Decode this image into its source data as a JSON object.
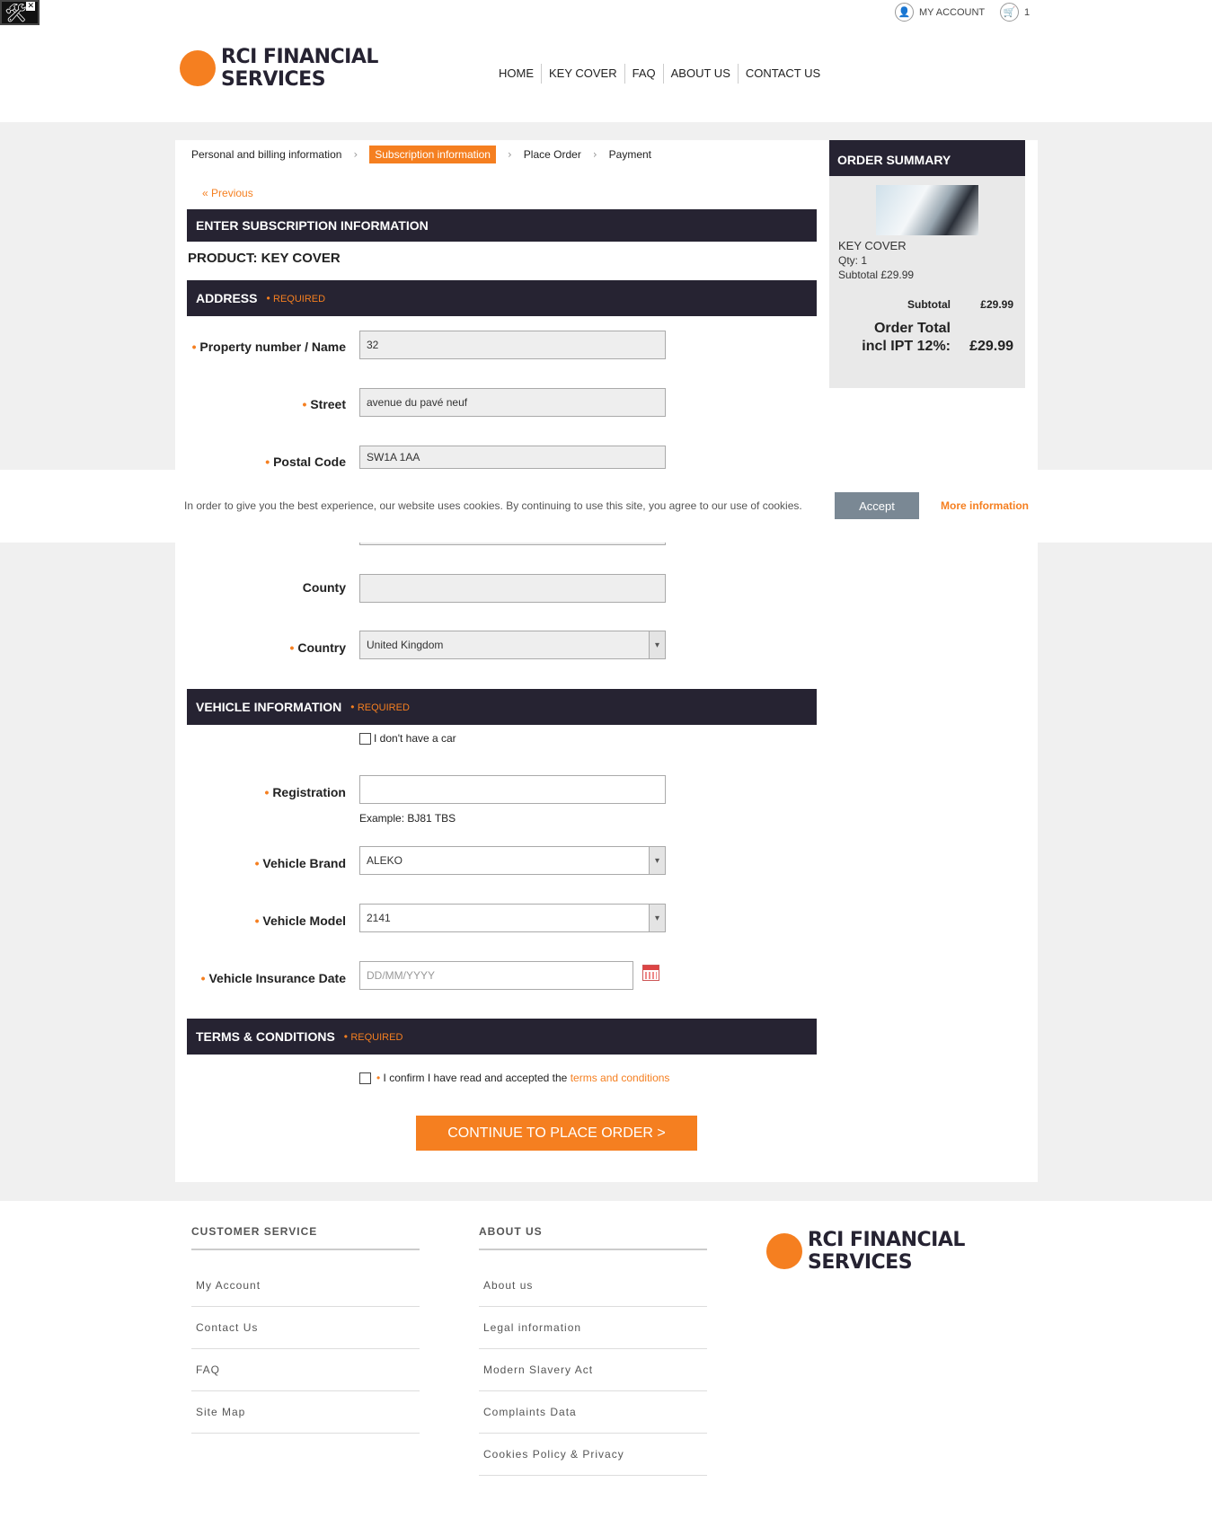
{
  "topbar": {
    "my_account": "MY ACCOUNT",
    "cart_count": "1"
  },
  "brand": {
    "line1": "RCI FINANCIAL",
    "line2": "SERVICES",
    "color": "#f57f20"
  },
  "nav": [
    "HOME",
    "KEY COVER",
    "FAQ",
    "ABOUT US",
    "CONTACT US"
  ],
  "steps": [
    "Personal and billing information",
    "Subscription information",
    "Place Order",
    "Payment"
  ],
  "previous": "Previous",
  "form": {
    "title": "ENTER SUBSCRIPTION INFORMATION",
    "product": "PRODUCT: KEY COVER",
    "required": "REQUIRED",
    "address": {
      "header": "ADDRESS",
      "property_label": "Property number / Name",
      "property_value": "32",
      "street_label": "Street",
      "street_value": "avenue du pavé neuf",
      "postal_label": "Postal Code",
      "postal_value": "SW1A 1AA",
      "county_label": "County",
      "county_value": "",
      "country_label": "Country",
      "country_value": "United Kingdom"
    },
    "vehicle": {
      "header": "VEHICLE INFORMATION",
      "no_car": "I don't have a car",
      "registration_label": "Registration",
      "registration_value": "",
      "registration_example": "Example: BJ81 TBS",
      "brand_label": "Vehicle Brand",
      "brand_value": "ALEKO",
      "model_label": "Vehicle Model",
      "model_value": "2141",
      "insurance_label": "Vehicle Insurance Date",
      "insurance_placeholder": "DD/MM/YYYY"
    },
    "terms": {
      "header": "TERMS & CONDITIONS",
      "text": "I confirm I have read and accepted the",
      "link": "terms and conditions"
    },
    "cta": "CONTINUE TO PLACE ORDER >"
  },
  "summary": {
    "header": "ORDER SUMMARY",
    "product": "KEY COVER",
    "qty": "Qty: 1",
    "line_subtotal": "Subtotal £29.99",
    "subtotal_label": "Subtotal",
    "subtotal_value": "£29.99",
    "total_label_1": "Order Total",
    "total_label_2": "incl IPT 12%:",
    "total_value": "£29.99"
  },
  "cookie": {
    "text": "In order to give you the best experience, our website uses cookies. By continuing to use this site, you agree to our use of cookies.",
    "accept": "Accept",
    "more": "More information"
  },
  "footer": {
    "customer_service": {
      "title": "CUSTOMER SERVICE",
      "items": [
        "My Account",
        "Contact Us",
        "FAQ",
        "Site Map"
      ]
    },
    "about_us": {
      "title": "ABOUT US",
      "items": [
        "About us",
        "Legal information",
        "Modern Slavery Act",
        "Complaints Data",
        "Cookies Policy & Privacy"
      ]
    }
  }
}
